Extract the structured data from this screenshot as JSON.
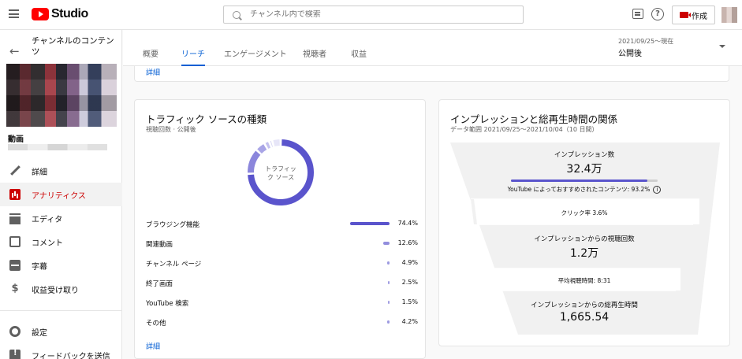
{
  "topbar": {
    "logo_text": "Studio",
    "search_placeholder": "チャンネル内で検索",
    "help_glyph": "?",
    "create_label": "作成"
  },
  "sidebar": {
    "back_glyph": "←",
    "channel_title": "チャンネルのコンテンツ",
    "video_label": "動画",
    "nav": [
      {
        "label": "詳細",
        "icon": "pencil-icon"
      },
      {
        "label": "アナリティクス",
        "icon": "analytics-icon",
        "active": true
      },
      {
        "label": "エディタ",
        "icon": "editor-icon"
      },
      {
        "label": "コメント",
        "icon": "comment-icon"
      },
      {
        "label": "字幕",
        "icon": "subtitle-icon"
      },
      {
        "label": "収益受け取り",
        "icon": "dollar-icon"
      }
    ],
    "dollar_glyph": "$",
    "settings_label": "設定",
    "feedback_label": "フィードバックを送信"
  },
  "header": {
    "tabs": [
      "概要",
      "リーチ",
      "エンゲージメント",
      "視聴者",
      "収益"
    ],
    "active_tab": "リーチ",
    "date_range": "2021/09/25～現在",
    "date_mode": "公開後"
  },
  "top_card": {
    "detail_link": "詳細"
  },
  "traffic": {
    "title": "トラフィック ソースの種類",
    "subtitle": "視聴回数 · 公開後",
    "donut_label_1": "トラフィッ",
    "donut_label_2": "ク ソース",
    "rows": [
      {
        "label": "ブラウジング機能",
        "pct": "74.4%",
        "value": 74.4
      },
      {
        "label": "関連動画",
        "pct": "12.6%",
        "value": 12.6
      },
      {
        "label": "チャンネル ページ",
        "pct": "4.9%",
        "value": 4.9
      },
      {
        "label": "終了画面",
        "pct": "2.5%",
        "value": 2.5
      },
      {
        "label": "YouTube 検索",
        "pct": "1.5%",
        "value": 1.5
      },
      {
        "label": "その他",
        "pct": "4.2%",
        "value": 4.2
      }
    ],
    "detail_link": "詳細",
    "accent": "#5a54cc"
  },
  "funnel": {
    "title": "インプレッションと総再生時間の関係",
    "subtitle": "データ範囲 2021/09/25～2021/10/04（10 日間）",
    "impressions_label": "インプレッション数",
    "impressions_value": "32.4万",
    "impressions_bar_fraction": 0.93,
    "recommended_text": "YouTube によっておすすめされたコンテンツ: 93.2%",
    "info_glyph": "i",
    "ctr_text": "クリック率 3.6%",
    "views_label": "インプレッションからの視聴回数",
    "views_value": "1.2万",
    "avg_watch_text": "平均視聴時間: 8:31",
    "watch_label": "インプレッションからの総再生時間",
    "watch_value": "1,665.54"
  }
}
